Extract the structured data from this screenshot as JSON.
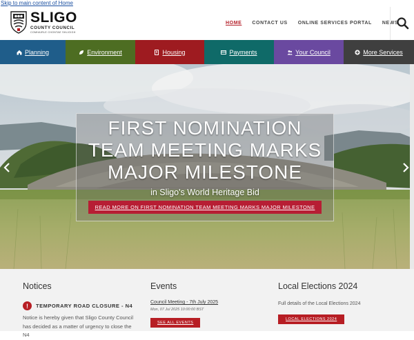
{
  "skip_link": "Skip to main content of Home",
  "logo": {
    "title": "SLIGO",
    "subtitle": "COUNTY COUNCIL",
    "irish": "COMHAIRLE CHONTAE SHLIGIGH",
    "icon": "crest-icon"
  },
  "topnav": [
    {
      "label": "HOME",
      "active": true
    },
    {
      "label": "CONTACT US"
    },
    {
      "label": "ONLINE SERVICES PORTAL"
    },
    {
      "label": "NEWS"
    }
  ],
  "search_icon": "search-icon",
  "mainnav": [
    {
      "label": "Planning",
      "icon": "home-icon",
      "color": "#1f5d8a"
    },
    {
      "label": "Environment",
      "icon": "leaf-icon",
      "color": "#4d6d22"
    },
    {
      "label": "Housing",
      "icon": "building-icon",
      "color": "#9e1b20"
    },
    {
      "label": "Payments",
      "icon": "credit-card-icon",
      "color": "#0f6a68"
    },
    {
      "label": "Your Council",
      "icon": "people-icon",
      "color": "#6a49a0"
    },
    {
      "label": "More Services",
      "icon": "plus-circle-icon",
      "color": "#3f3f3f"
    }
  ],
  "hero": {
    "title": "FIRST NOMINATION TEAM MEETING MARKS MAJOR MILESTONE",
    "title_lines": [
      "FIRST NOMINATION",
      "TEAM MEETING MARKS",
      "MAJOR MILESTONE"
    ],
    "subtitle": "in Sligo's World Heritage Bid",
    "button": "READ MORE ON FIRST NOMINATION TEAM MEETING MARKS MAJOR MILESTONE"
  },
  "notices": {
    "heading": "Notices",
    "item_title": "TEMPORARY ROAD CLOSURE - N4",
    "item_text": "Notice is hereby given that Sligo County Council has decided as a matter of urgency to close the N4"
  },
  "events": {
    "heading": "Events",
    "item_title": "Council Meeting - 7th July 2025",
    "item_date": "Mon, 07 Jul 2025 10:00:00 BST",
    "button": "SEE ALL EVENTS"
  },
  "elections": {
    "heading": "Local Elections 2024",
    "text": "Full details of the Local Elections 2024",
    "button": "LOCAL ELECTIONS 2024"
  },
  "colors": {
    "accent_red": "#b71e24",
    "nav_active": "#b4202a"
  }
}
